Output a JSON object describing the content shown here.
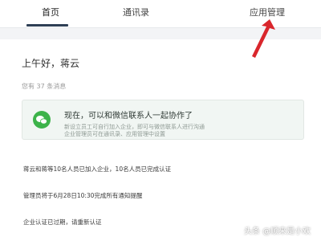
{
  "tabs": [
    {
      "label": "首页",
      "active": true
    },
    {
      "label": "通讯录",
      "active": false
    },
    {
      "label": "应用管理",
      "active": false
    }
  ],
  "greeting": "上午好，蒋云",
  "message_count": "您有 37 条消息",
  "notice": {
    "icon": "wechat-icon",
    "title": "现在，可以和微信联系人一起协作了",
    "line1": "新设立员工可自行加入企业，即可与微信联系人进行沟通",
    "line2": "企业管理员可在通讯录、应用管理中设置"
  },
  "messages": [
    "蒋云和蒋等10名人员已加入企业，10名人员已完成认证",
    "管理员将于6月28日10:30完成所有通知提醒",
    "企业认证已过期，请重新认证"
  ],
  "watermark": "头条 @顺来是小欢",
  "colors": {
    "active_tab_underline": "#2e3f55",
    "annotation_arrow": "#d9262c",
    "wechat_green": "#3db34a"
  }
}
